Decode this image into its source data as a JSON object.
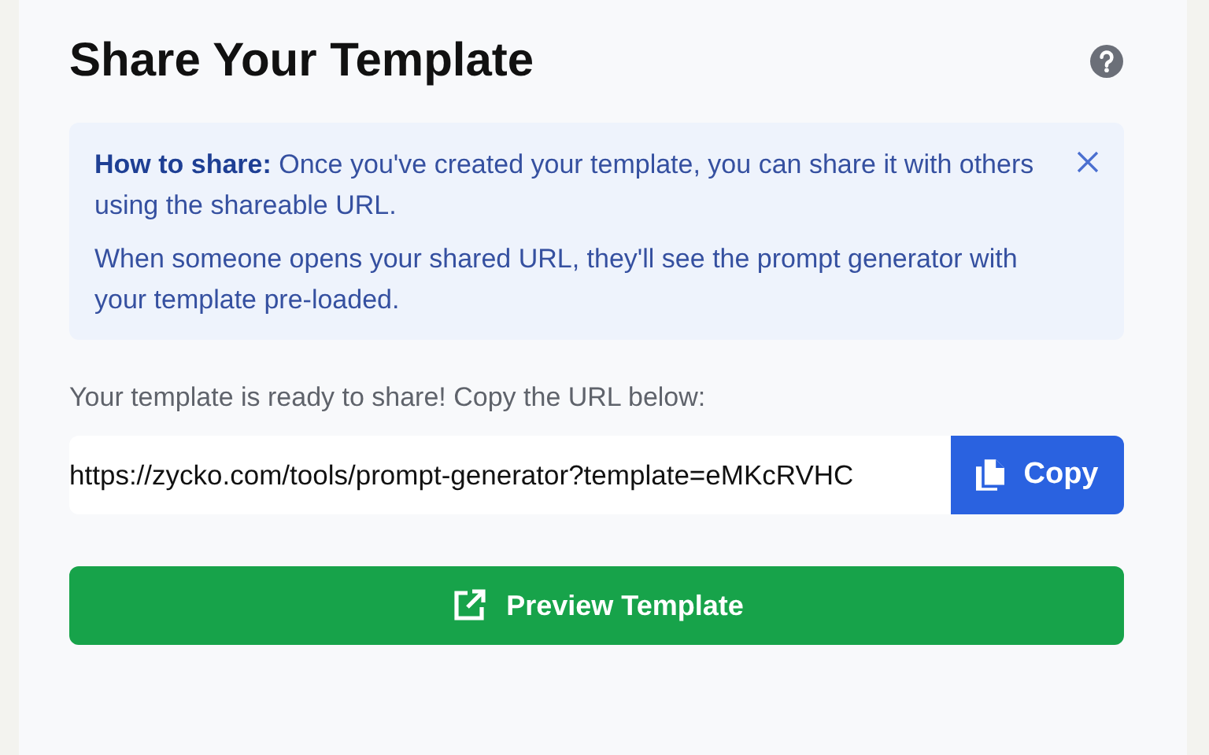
{
  "title": "Share Your Template",
  "info": {
    "paragraphs": [
      "**How to share:** Once you've created your template, you can share it with others using the shareable URL.",
      "When someone opens your shared URL, they'll see the prompt generator with your template pre-loaded."
    ]
  },
  "prompt": "Your template is ready to share! Copy the URL below:",
  "url_field": {
    "value": "https://zycko.com/tools/prompt-generator?template=eMKcRVHC"
  },
  "copy_button": "Copy",
  "preview_button": "Preview Template"
}
